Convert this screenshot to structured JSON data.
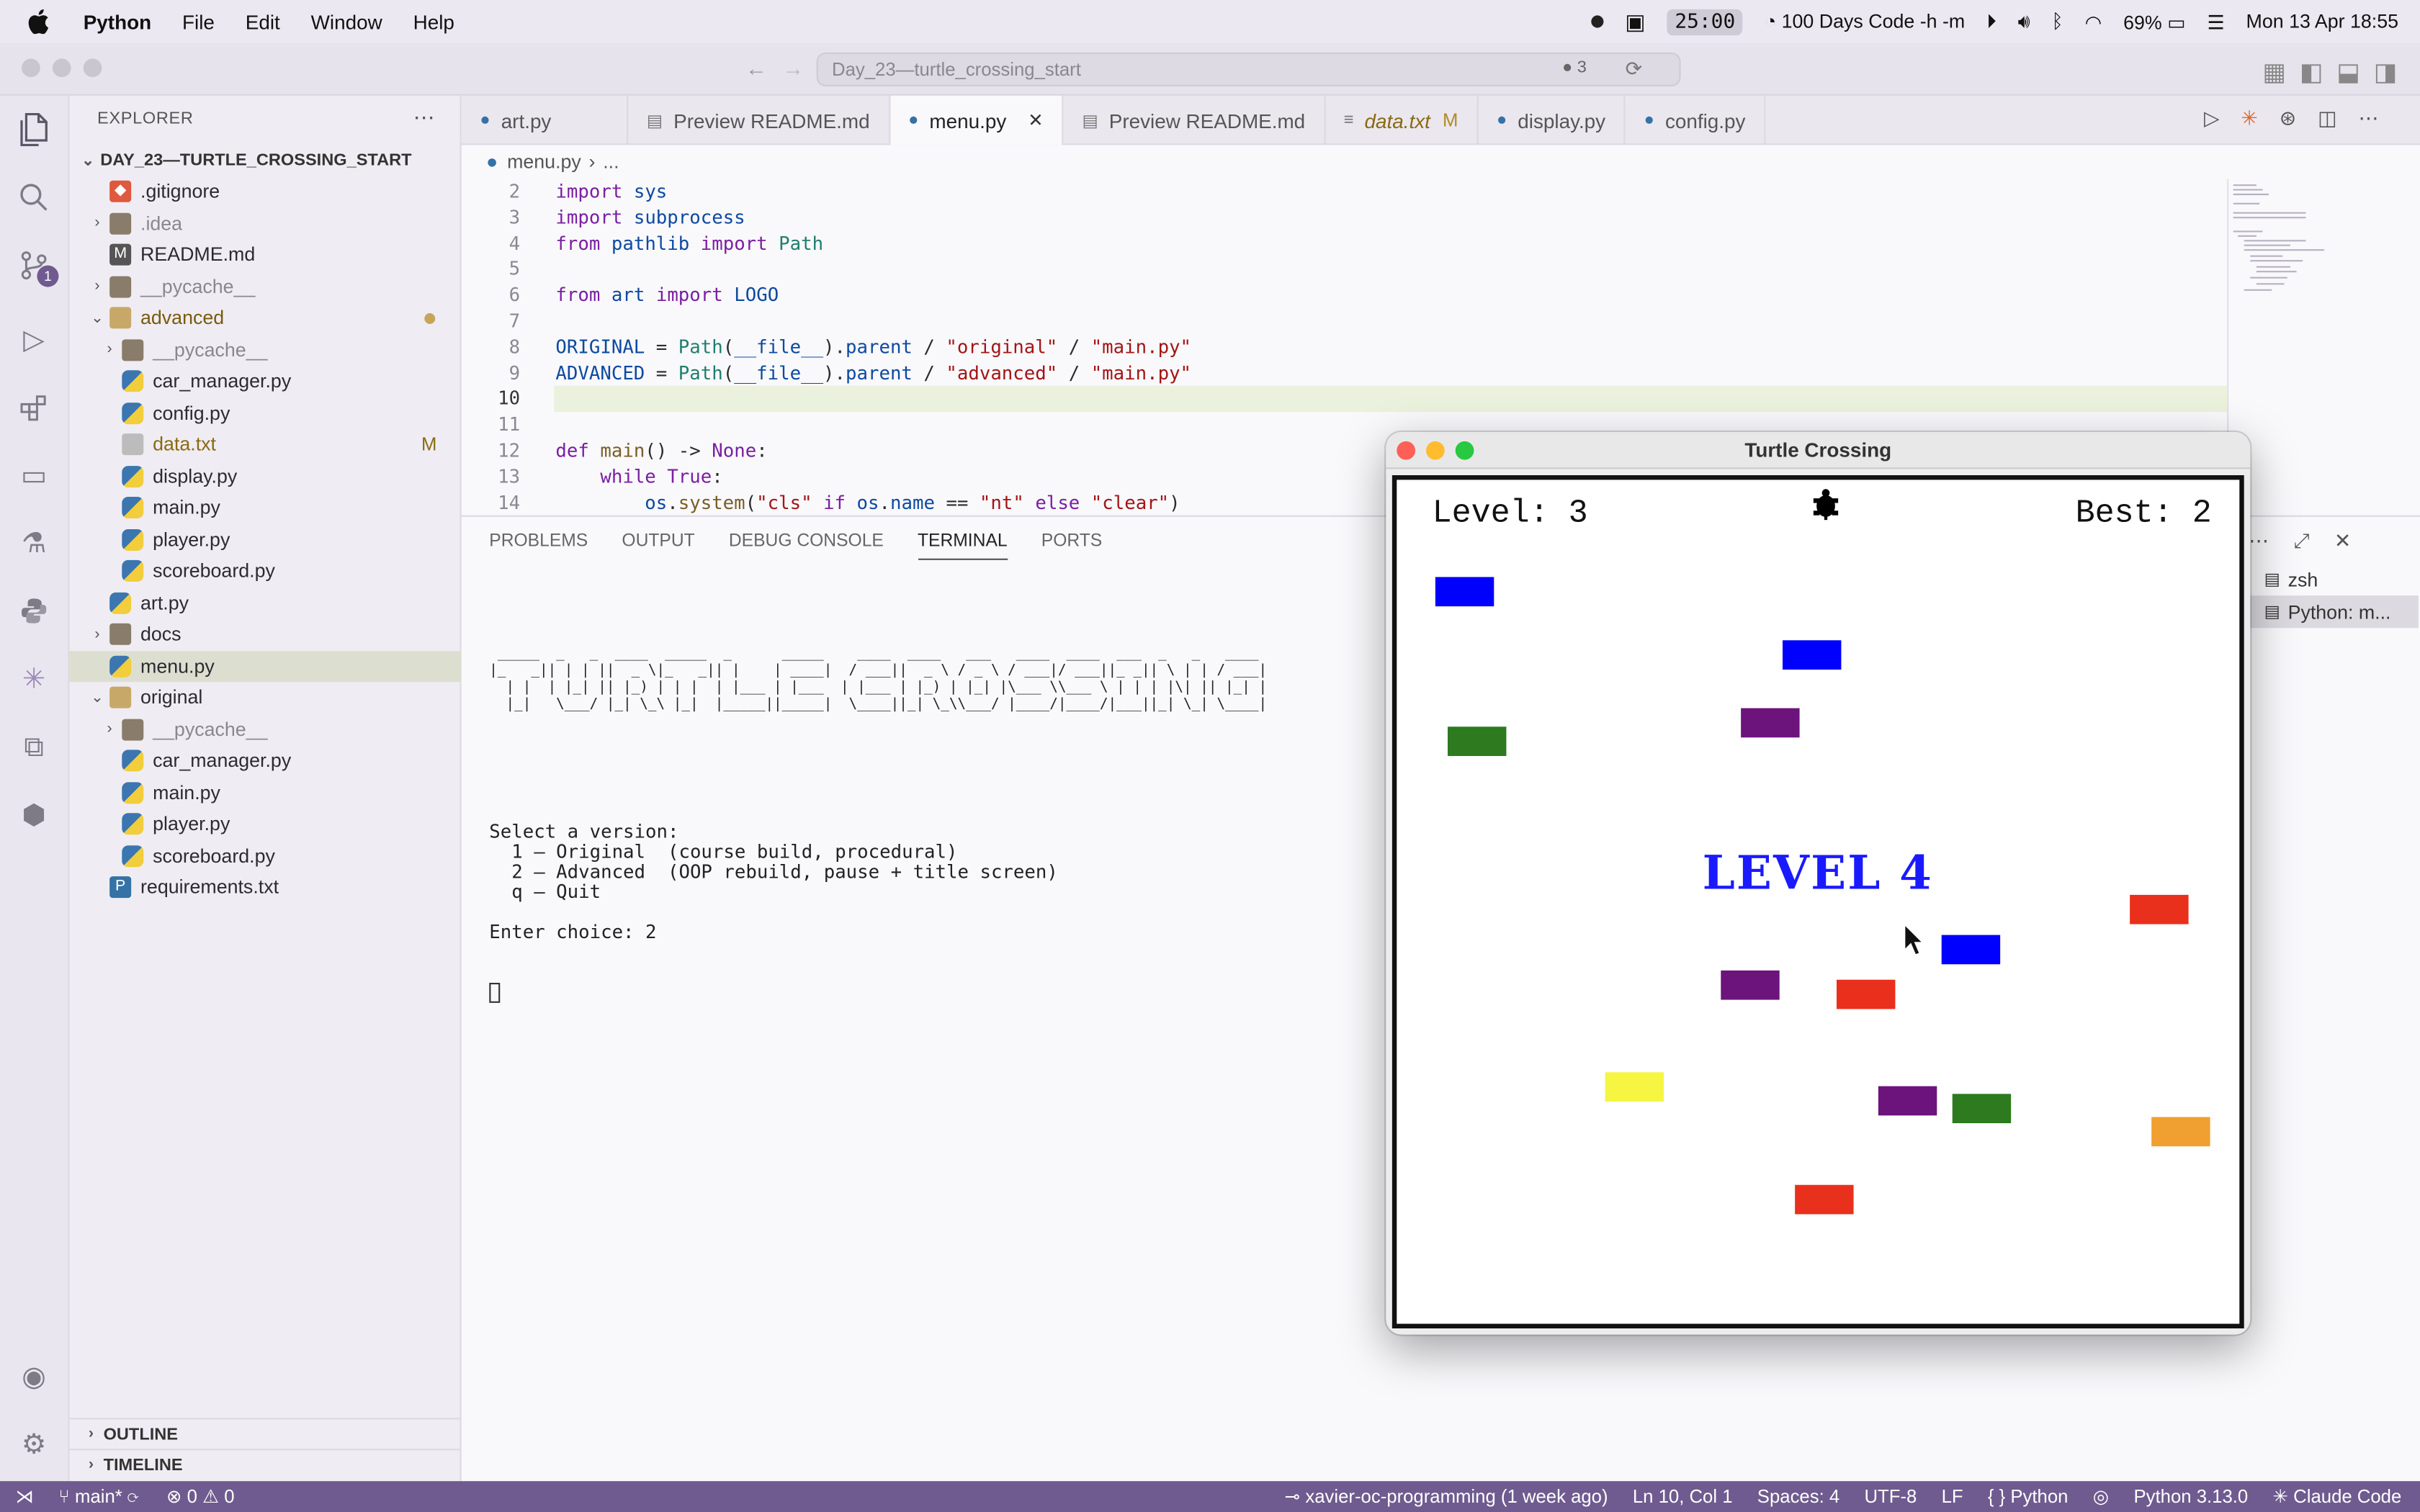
{
  "menubar": {
    "app": "Python",
    "items": [
      "File",
      "Edit",
      "Window",
      "Help"
    ],
    "timer": "25:00",
    "focus_label": "100 Days Code -h -m",
    "battery": "69%",
    "datetime": "Mon 13 Apr  18:55"
  },
  "window": {
    "command_center": "Day_23—turtle_crossing_start",
    "command_badge": "3"
  },
  "sidebar": {
    "title": "EXPLORER",
    "root": "DAY_23—TURTLE_CROSSING_START",
    "items": [
      {
        "label": ".gitignore",
        "icon": "git-file-icon",
        "depth": 1,
        "chevron": ""
      },
      {
        "label": ".idea",
        "icon": "folder-icon",
        "depth": 1,
        "chevron": "›"
      },
      {
        "label": "README.md",
        "icon": "markdown-file-icon",
        "depth": 1,
        "chevron": ""
      },
      {
        "label": "__pycache__",
        "icon": "folder-icon",
        "depth": 1,
        "chevron": "›"
      },
      {
        "label": "advanced",
        "icon": "folder-open-icon",
        "depth": 1,
        "chevron": "⌄",
        "dot": true
      },
      {
        "label": "__pycache__",
        "icon": "folder-icon",
        "depth": 2,
        "chevron": "›"
      },
      {
        "label": "car_manager.py",
        "icon": "python-file-icon",
        "depth": 2,
        "chevron": ""
      },
      {
        "label": "config.py",
        "icon": "python-file-icon",
        "depth": 2,
        "chevron": ""
      },
      {
        "label": "data.txt",
        "icon": "text-file-icon",
        "depth": 2,
        "chevron": "",
        "mod": "M"
      },
      {
        "label": "display.py",
        "icon": "python-file-icon",
        "depth": 2,
        "chevron": ""
      },
      {
        "label": "main.py",
        "icon": "python-file-icon",
        "depth": 2,
        "chevron": ""
      },
      {
        "label": "player.py",
        "icon": "python-file-icon",
        "depth": 2,
        "chevron": ""
      },
      {
        "label": "scoreboard.py",
        "icon": "python-file-icon",
        "depth": 2,
        "chevron": ""
      },
      {
        "label": "art.py",
        "icon": "python-file-icon",
        "depth": 1,
        "chevron": ""
      },
      {
        "label": "docs",
        "icon": "folder-icon",
        "depth": 1,
        "chevron": "›"
      },
      {
        "label": "menu.py",
        "icon": "python-file-icon",
        "depth": 1,
        "chevron": "",
        "selected": true
      },
      {
        "label": "original",
        "icon": "folder-open-icon",
        "depth": 1,
        "chevron": "⌄"
      },
      {
        "label": "__pycache__",
        "icon": "folder-icon",
        "depth": 2,
        "chevron": "›"
      },
      {
        "label": "car_manager.py",
        "icon": "python-file-icon",
        "depth": 2,
        "chevron": ""
      },
      {
        "label": "main.py",
        "icon": "python-file-icon",
        "depth": 2,
        "chevron": ""
      },
      {
        "label": "player.py",
        "icon": "python-file-icon",
        "depth": 2,
        "chevron": ""
      },
      {
        "label": "scoreboard.py",
        "icon": "python-file-icon",
        "depth": 2,
        "chevron": ""
      },
      {
        "label": "requirements.txt",
        "icon": "requirements-file-icon",
        "depth": 1,
        "chevron": ""
      }
    ],
    "outline": "OUTLINE",
    "timeline": "TIMELINE"
  },
  "tabs": [
    {
      "label": "art.py",
      "icon": "python-file-icon"
    },
    {
      "label": "Preview README.md",
      "icon": "preview-icon"
    },
    {
      "label": "menu.py",
      "icon": "python-file-icon",
      "active": true
    },
    {
      "label": "Preview README.md",
      "icon": "preview-icon"
    },
    {
      "label": "data.txt",
      "icon": "text-file-icon",
      "mod": "M",
      "italic": true
    },
    {
      "label": "display.py",
      "icon": "python-file-icon"
    },
    {
      "label": "config.py",
      "icon": "python-file-icon"
    }
  ],
  "breadcrumb": {
    "file": "menu.py",
    "rest": "..."
  },
  "editor": {
    "lines": [
      {
        "n": "2",
        "html": "<span class='kw'>import</span> <span class='var'>sys</span>"
      },
      {
        "n": "3",
        "html": "<span class='kw'>import</span> <span class='var'>subprocess</span>"
      },
      {
        "n": "4",
        "html": "<span class='kw'>from</span> <span class='var'>pathlib</span> <span class='kw'>import</span> <span class='cls'>Path</span>"
      },
      {
        "n": "5",
        "html": ""
      },
      {
        "n": "6",
        "html": "<span class='kw'>from</span> <span class='var'>art</span> <span class='kw'>import</span> <span class='var'>LOGO</span>"
      },
      {
        "n": "7",
        "html": ""
      },
      {
        "n": "8",
        "html": "<span class='var'>ORIGINAL</span> = <span class='cls'>Path</span>(<span class='var'>__file__</span>).<span class='var'>parent</span> / <span class='str'>\"original\"</span> / <span class='str'>\"main.py\"</span>"
      },
      {
        "n": "9",
        "html": "<span class='var'>ADVANCED</span> = <span class='cls'>Path</span>(<span class='var'>__file__</span>).<span class='var'>parent</span> / <span class='str'>\"advanced\"</span> / <span class='str'>\"main.py\"</span>"
      },
      {
        "n": "10",
        "html": ""
      },
      {
        "n": "11",
        "html": ""
      },
      {
        "n": "12",
        "html": "<span class='kw'>def</span> <span class='fn'>main</span>() -&gt; <span class='kw'>None</span>:"
      },
      {
        "n": "13",
        "html": "    <span class='kw'>while</span> <span class='kw'>True</span>:"
      },
      {
        "n": "14",
        "html": "        <span class='var'>os</span>.<span class='fn'>system</span>(<span class='str'>\"cls\"</span> <span class='kw'>if</span> <span class='var'>os</span>.<span class='var'>name</span> == <span class='str'>\"nt\"</span> <span class='kw'>else</span> <span class='str'>\"clear\"</span>)"
      }
    ]
  },
  "panel": {
    "tabs": [
      "PROBLEMS",
      "OUTPUT",
      "DEBUG CONSOLE",
      "TERMINAL",
      "PORTS"
    ],
    "active_tab": "TERMINAL",
    "ascii_logo": [
      " _____  _   _  ____  _____  _      _____    ____  ____   ___   ____  ____  ___  _   _   ____ ",
      "|_   _|| | | ||  _ \\|_   _|| |    | ____|  / ___||  _ \\ / _ \\ / ___|/ ___||_ _|| \\ | | / ___|",
      "  | |  | |_| || |_) | | |  | |___ | |___  | |___ | |_) | |_| |\\___ \\\\___ \\ | | | |\\| || |_| |",
      "  |_|   \\___/ |_| \\_\\ |_|  |_____||_____|  \\____||_| \\_\\\\___/ |____/|____/|___||_| \\_| \\____|"
    ],
    "lines": [
      "Select a version:",
      "  1 — Original  (course build, procedural)",
      "  2 — Advanced  (OOP rebuild, pause + title screen)",
      "  q — Quit",
      "",
      "Enter choice: 2"
    ],
    "terminals": [
      "zsh",
      "Python: m..."
    ]
  },
  "game": {
    "title": "Turtle Crossing",
    "level_label": "Level: 3",
    "best_label": "Best: 2",
    "banner": "LEVEL 4",
    "colors": {
      "blue": "#0000ff",
      "green": "#2d7a1f",
      "purple": "#6c137c",
      "red": "#e8301c",
      "yellow": "#f5f542",
      "orange": "#f0a030"
    }
  },
  "status": {
    "branch": "main*",
    "problems": "⊗ 0 ⚠ 0",
    "blame": "xavier-oc-programming (1 week ago)",
    "cursor": "Ln 10, Col 1",
    "spaces": "Spaces: 4",
    "encoding": "UTF-8",
    "eol": "LF",
    "language": "{ } Python",
    "interpreter": "Python 3.13.0",
    "claude": "✳ Claude Code"
  }
}
